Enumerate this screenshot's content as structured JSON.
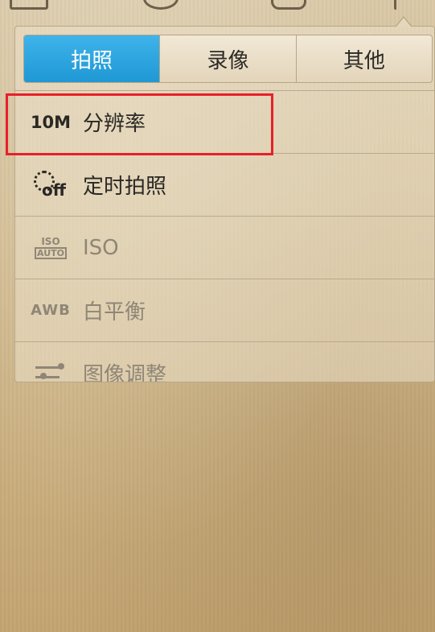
{
  "tabs": [
    {
      "label": "拍照",
      "active": true
    },
    {
      "label": "录像",
      "active": false
    },
    {
      "label": "其他",
      "active": false
    }
  ],
  "settings": [
    {
      "icon_text": "10M",
      "icon": "resolution-10m-icon",
      "label": "分辨率",
      "enabled": true
    },
    {
      "icon_text": "off",
      "icon": "self-timer-off-icon",
      "label": "定时拍照",
      "enabled": true
    },
    {
      "icon_text": "ISO",
      "icon_sub": "AUTO",
      "icon": "iso-auto-icon",
      "label": "ISO",
      "enabled": false
    },
    {
      "icon_text": "AWB",
      "icon": "white-balance-auto-icon",
      "label": "白平衡",
      "enabled": false
    },
    {
      "icon": "image-adjust-icon",
      "label": "图像调整",
      "enabled": false
    }
  ],
  "colors": {
    "active_tab": "#1f98d4",
    "highlight": "#e8202a"
  }
}
